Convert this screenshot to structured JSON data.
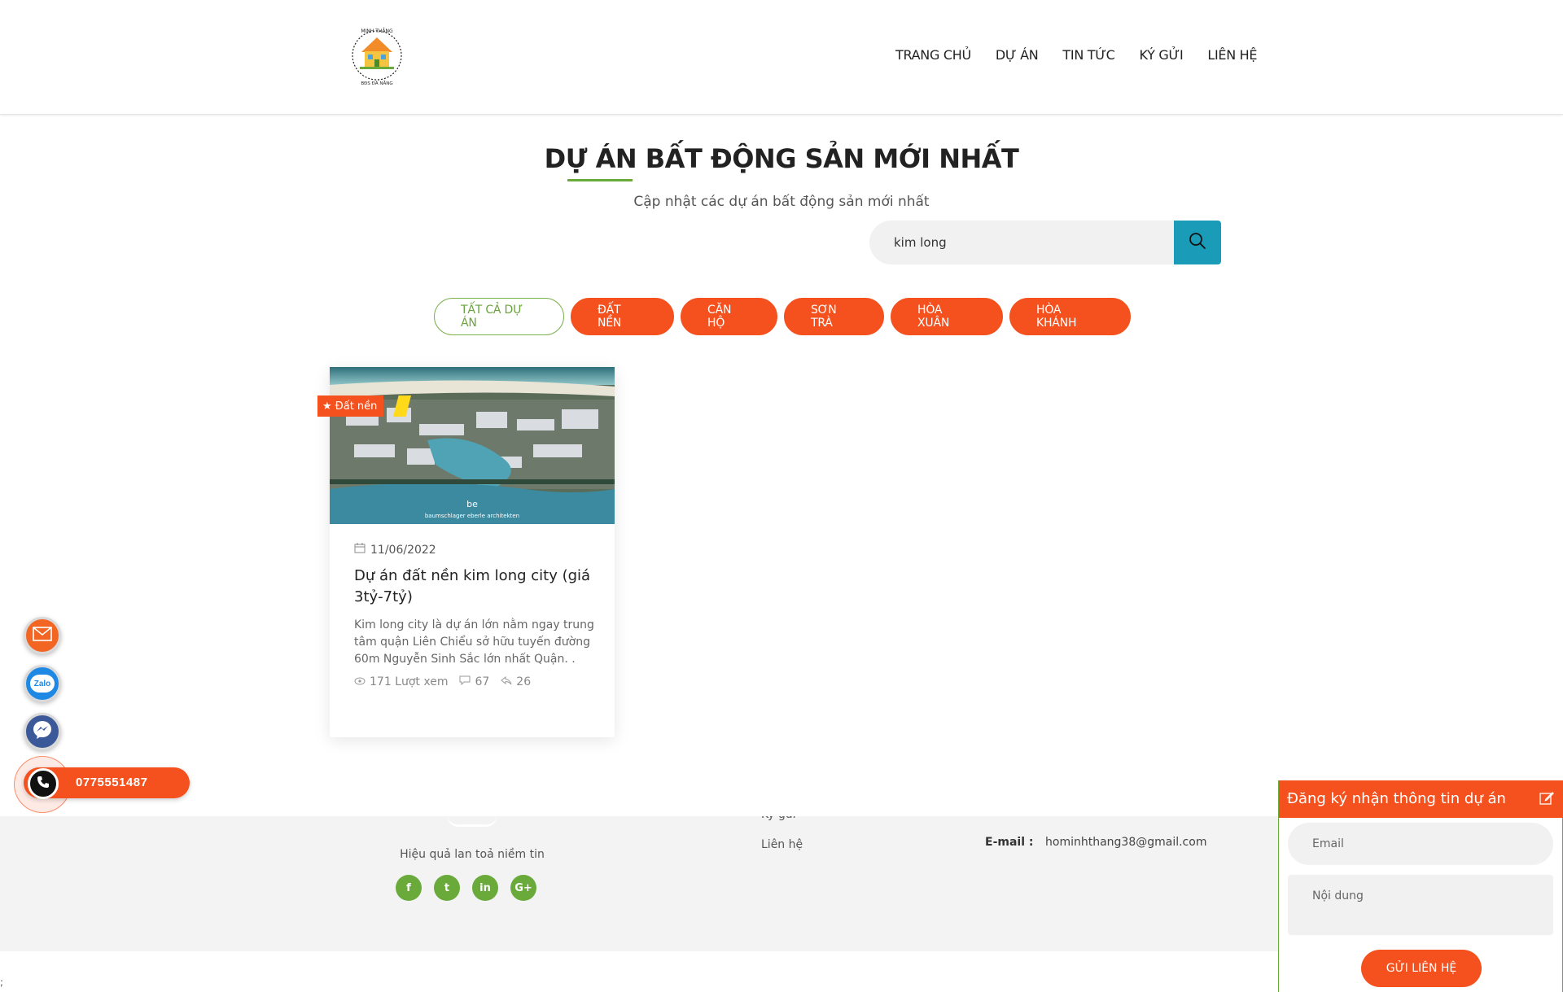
{
  "header": {
    "logo_alt": "MINH THẮNG BẤT ĐỘNG SẢN ĐÀ NẴNG",
    "nav": [
      {
        "label": "TRANG CHỦ"
      },
      {
        "label": "DỰ ÁN"
      },
      {
        "label": "TIN TỨC"
      },
      {
        "label": "KÝ GỬI"
      },
      {
        "label": "LIÊN HỆ"
      }
    ]
  },
  "main": {
    "title": "DỰ ÁN BẤT ĐỘNG SẢN MỚI NHẤT",
    "subtitle": "Cập nhật các dự án bất động sản mới nhất",
    "search": {
      "value": "kim long",
      "button_icon": "search-icon"
    },
    "filters": [
      {
        "label": "TẤT CẢ DỰ ÁN",
        "active": true
      },
      {
        "label": "ĐẤT NỀN"
      },
      {
        "label": "CĂN HỘ"
      },
      {
        "label": "SƠN TRÀ"
      },
      {
        "label": "HÒA XUÂN"
      },
      {
        "label": "HÒA KHÁNH"
      }
    ],
    "card": {
      "badge": "Đất nền",
      "date": "11/06/2022",
      "title": "Dự án đất nền kim long city (giá 3tỷ-7tỷ)",
      "description": "Kim long city là dự án lớn nằm ngay trung tâm quận Liên Chiểu sở hữu tuyến đường 60m Nguyễn Sinh Sắc lớn nhất Quận. .",
      "views": "171 Lượt xem",
      "comments": "67",
      "shares": "26",
      "image_watermark": "baumschlager eberle architekten"
    }
  },
  "footer": {
    "cut_link": "Ký gửi",
    "slogan": "Hiệu quả lan toả niềm tin",
    "link_contact": "Liên hệ",
    "email_label": "E-mail :",
    "email_value": "hominhthang38@gmail.com",
    "bottom_mark": ";",
    "socials": [
      {
        "icon": "facebook-icon",
        "glyph": "f"
      },
      {
        "icon": "twitter-icon",
        "glyph": "t"
      },
      {
        "icon": "linkedin-icon",
        "glyph": "in"
      },
      {
        "icon": "google-plus-icon",
        "glyph": "G+"
      }
    ]
  },
  "contact_float": {
    "phone": "0775551487",
    "zalo_label": "Zalo"
  },
  "subscribe": {
    "title": "Đăng ký nhận thông tin dự án",
    "email_placeholder": "Email",
    "content_placeholder": "Nội dung",
    "send_label": "GỬI LIÊN HỆ"
  },
  "colors": {
    "accent": "#f4511e",
    "green": "#6aaa3a",
    "search_button": "#1a9bb8"
  }
}
